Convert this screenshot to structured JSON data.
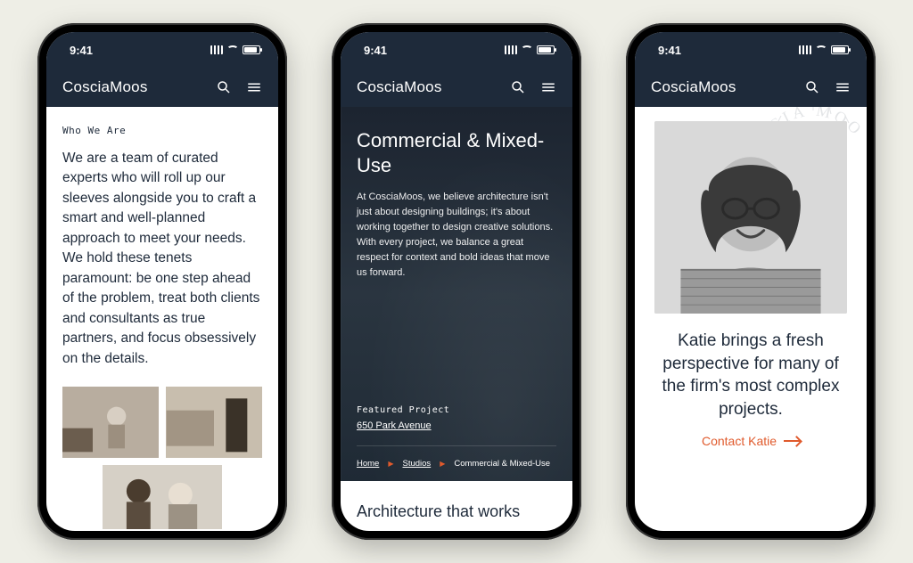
{
  "status": {
    "time": "9:41"
  },
  "brand": "CosciaMoos",
  "screens": {
    "about": {
      "eyebrow": "Who We Are",
      "copy": "We are a team of curated experts who will roll up our sleeves alongside you to craft a smart and well-planned approach to meet your needs. We hold these tenets paramount: be one step ahead of the problem, treat both clients and consultants as true partners, and focus obsessively on the details."
    },
    "studio": {
      "title": "Commercial & Mixed-Use",
      "desc": "At CosciaMoos, we believe architecture isn't just about designing buildings; it's about working together to design creative solutions. With every project, we balance a great respect for context and bold ideas that move us forward.",
      "featured_label": "Featured Project",
      "featured_name": "650 Park Avenue",
      "crumbs": {
        "home": "Home",
        "studios": "Studios",
        "current": "Commercial & Mixed-Use"
      },
      "headline_below": "Architecture that works"
    },
    "person": {
      "quote": "Katie brings a fresh perspective for many of the firm's most complex projects.",
      "cta": "Contact Katie"
    }
  }
}
